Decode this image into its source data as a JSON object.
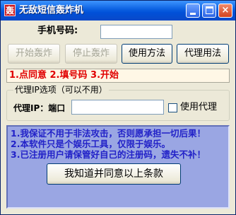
{
  "window": {
    "title": "无敌短信轰炸机",
    "app_icon_glyph": "轰",
    "controls": {
      "minimize": "minimize",
      "maximize": "maximize",
      "close": "×"
    }
  },
  "phone": {
    "label": "手机号码:",
    "value": ""
  },
  "buttons": {
    "start": "开始轰炸",
    "stop": "停止轰炸",
    "usage": "使用方法",
    "proxy_usage": "代理用法"
  },
  "steps_text": "1.点同意 2.填号码 3.开始",
  "proxy": {
    "group_title": "代理IP选项（可以不用）",
    "label": "代理IP：端口",
    "value": "",
    "use_proxy_label": "使用代理",
    "use_proxy_checked": false
  },
  "terms": [
    "1.我保证不用于非法攻击，否则愿承担一切后果！",
    "2.本软件只是个娱乐工具，仅限于娱乐。",
    "3.已注册用户请保管好自己的注册码，遗失不补！"
  ],
  "agree_button": "我知道并同意以上条款",
  "colors": {
    "steps_text": "#e00000",
    "terms_text": "#2222c8",
    "terms_bg": "#9aa6e3"
  }
}
